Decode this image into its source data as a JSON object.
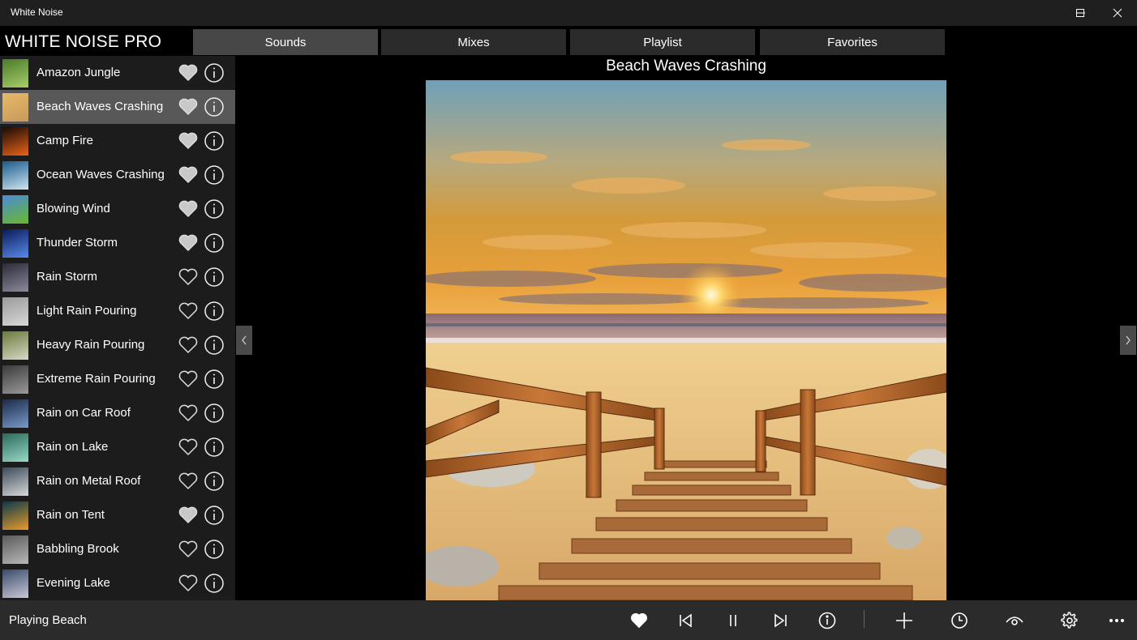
{
  "window": {
    "title": "White Noise"
  },
  "app": {
    "name": "WHITE NOISE PRO"
  },
  "tabs": [
    {
      "label": "Sounds",
      "active": true
    },
    {
      "label": "Mixes",
      "active": false
    },
    {
      "label": "Playlist",
      "active": false
    },
    {
      "label": "Favorites",
      "active": false
    }
  ],
  "sounds": [
    {
      "label": "Amazon Jungle",
      "favorite": true,
      "selected": false,
      "thumb": [
        "#4a7a2a",
        "#a8cf6a"
      ]
    },
    {
      "label": "Beach Waves Crashing",
      "favorite": true,
      "selected": true,
      "thumb": [
        "#e8b86a",
        "#c89a5a"
      ]
    },
    {
      "label": "Camp Fire",
      "favorite": true,
      "selected": false,
      "thumb": [
        "#1a0a05",
        "#e8641a"
      ]
    },
    {
      "label": "Ocean Waves Crashing",
      "favorite": true,
      "selected": false,
      "thumb": [
        "#1a5a8a",
        "#cfe6f2"
      ]
    },
    {
      "label": "Blowing Wind",
      "favorite": true,
      "selected": false,
      "thumb": [
        "#4a8ad8",
        "#6ab82a"
      ]
    },
    {
      "label": "Thunder Storm",
      "favorite": true,
      "selected": false,
      "thumb": [
        "#0a1a5a",
        "#5a8ae8"
      ]
    },
    {
      "label": "Rain Storm",
      "favorite": false,
      "selected": false,
      "thumb": [
        "#2a2a3a",
        "#8a8a9a"
      ]
    },
    {
      "label": "Light Rain Pouring",
      "favorite": false,
      "selected": false,
      "thumb": [
        "#9a9a9a",
        "#d8d8d8"
      ]
    },
    {
      "label": "Heavy Rain Pouring",
      "favorite": false,
      "selected": false,
      "thumb": [
        "#6a7a3a",
        "#d8d8c8"
      ]
    },
    {
      "label": "Extreme Rain Pouring",
      "favorite": false,
      "selected": false,
      "thumb": [
        "#3a3a3a",
        "#9a9a9a"
      ]
    },
    {
      "label": "Rain on Car Roof",
      "favorite": false,
      "selected": false,
      "thumb": [
        "#1a2a4a",
        "#7a9ac8"
      ]
    },
    {
      "label": "Rain on Lake",
      "favorite": false,
      "selected": false,
      "thumb": [
        "#2a6a5a",
        "#9ad8c8"
      ]
    },
    {
      "label": "Rain on Metal Roof",
      "favorite": false,
      "selected": false,
      "thumb": [
        "#3a4a5a",
        "#d8d8d8"
      ]
    },
    {
      "label": "Rain on Tent",
      "favorite": true,
      "selected": false,
      "thumb": [
        "#0a3a4a",
        "#e89a2a"
      ]
    },
    {
      "label": "Babbling Brook",
      "favorite": false,
      "selected": false,
      "thumb": [
        "#5a5a5a",
        "#b8b8b8"
      ]
    },
    {
      "label": "Evening Lake",
      "favorite": false,
      "selected": false,
      "thumb": [
        "#3a4a6a",
        "#c8c8d8"
      ]
    }
  ],
  "main": {
    "title": "Beach Waves Crashing"
  },
  "status": {
    "text": "Playing Beach"
  },
  "controls": [
    {
      "name": "favorite-button",
      "icon": "heart-icon"
    },
    {
      "name": "previous-button",
      "icon": "skip-previous-icon"
    },
    {
      "name": "pause-button",
      "icon": "pause-icon"
    },
    {
      "name": "next-button",
      "icon": "skip-next-icon"
    },
    {
      "name": "info-button",
      "icon": "info-icon"
    },
    {
      "name": "add-button",
      "icon": "plus-icon"
    },
    {
      "name": "timer-button",
      "icon": "clock-icon"
    },
    {
      "name": "view-button",
      "icon": "eye-icon"
    },
    {
      "name": "settings-button",
      "icon": "gear-icon"
    },
    {
      "name": "more-button",
      "icon": "ellipsis-icon"
    }
  ],
  "colors": {
    "accent_selected": "#585858",
    "sidebar": "#1c1c1c",
    "bar": "#2b2b2b"
  }
}
